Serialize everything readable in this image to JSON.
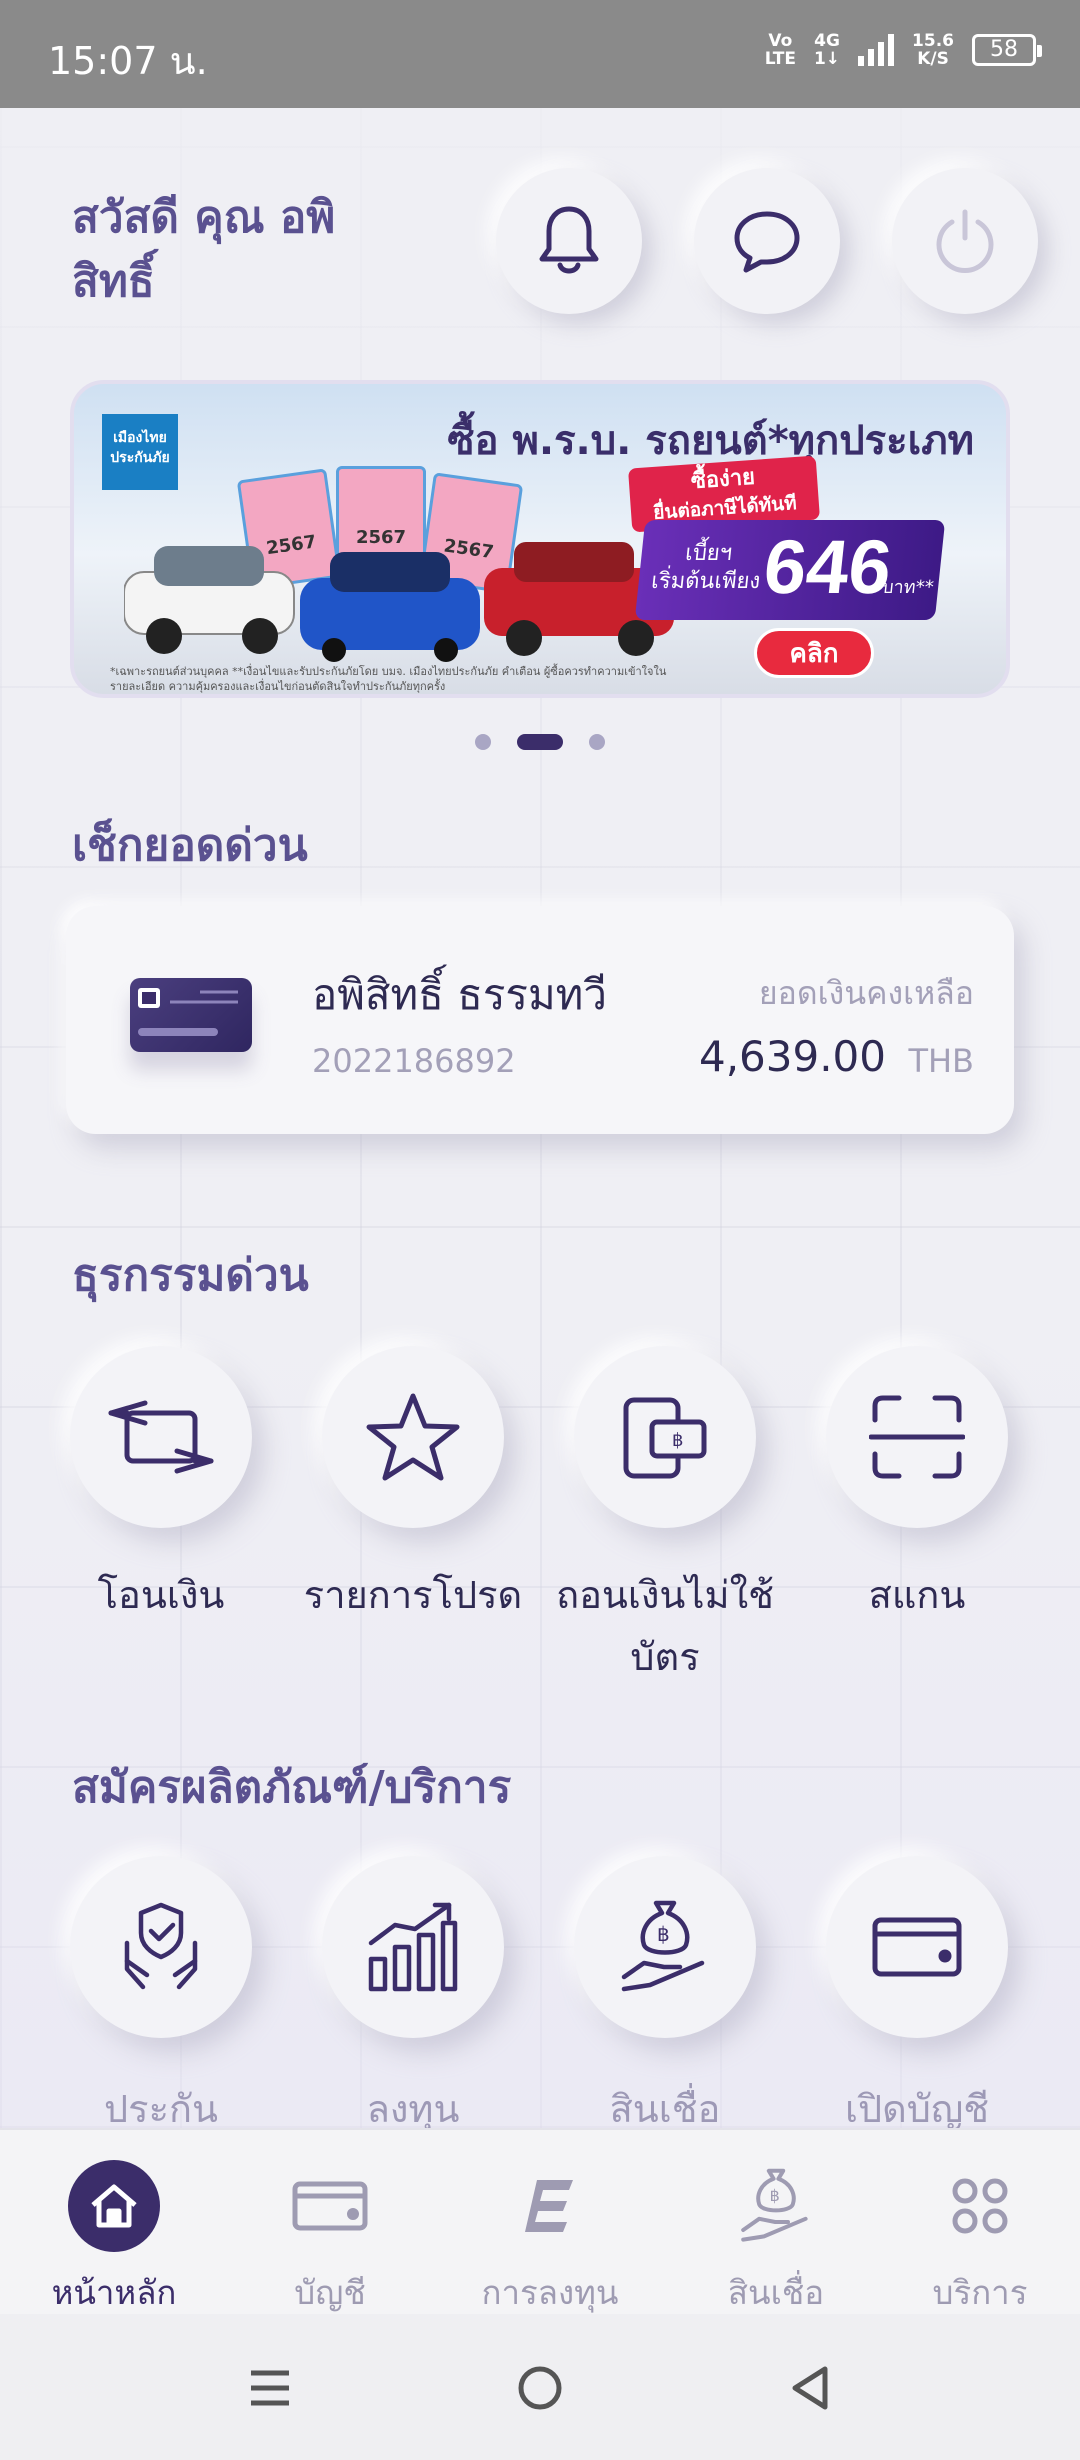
{
  "status_bar": {
    "time": "15:07 น.",
    "volte_top": "Vo",
    "volte_bottom": "LTE",
    "network_top": "4G",
    "network_bottom": "1↓",
    "speed_value": "15.6",
    "speed_unit": "K/S",
    "battery": "58"
  },
  "header": {
    "greeting": "สวัสดี คุณ อพิสิทธิ์",
    "buttons": [
      {
        "name": "notification",
        "icon": "bell-icon"
      },
      {
        "name": "chat",
        "icon": "chat-bubble-icon"
      },
      {
        "name": "logout",
        "icon": "power-icon"
      }
    ]
  },
  "banner": {
    "title": "ซื้อ พ.ร.บ. รถยนต์*ทุกประเภท",
    "logo_line1": "เมืองไทย",
    "logo_line2": "ประกันภัย",
    "tag1_line1": "ซื้อง่าย",
    "tag1_line2": "ยื่นต่อภาษีได้ทันที",
    "price_prefix_line1": "เบี้ยฯ",
    "price_prefix_line2": "เริ่มต้นเพียง",
    "price": "646",
    "price_unit": "บาท**",
    "cta": "คลิก",
    "sticker_number": "2567",
    "fine_print": "*เฉพาะรถยนต์ส่วนบุคคล **เงื่อนไขและรับประกันภัยโดย บมจ. เมืองไทยประกันภัย คำเตือน ผู้ซื้อควรทำความเข้าใจในรายละเอียด ความคุ้มครองและเงื่อนไขก่อนตัดสินใจทำประกันภัยทุกครั้ง",
    "page_count": 3,
    "active_page": 2
  },
  "balance": {
    "section_title": "เช็กยอดด่วน",
    "account_name": "อพิสิทธิ์ ธรรมทวี",
    "account_number": "2022186892",
    "balance_label": "ยอดเงินคงเหลือ",
    "amount": "4,639.00",
    "currency": "THB"
  },
  "quick_actions": {
    "section_title": "ธุรกรรมด่วน",
    "items": [
      {
        "label": "โอนเงิน",
        "icon": "transfer-icon"
      },
      {
        "label": "รายการโปรด",
        "icon": "star-icon"
      },
      {
        "label": "ถอนเงินไม่ใช้บัตร",
        "icon": "cardless-withdraw-icon"
      },
      {
        "label": "สแกน",
        "icon": "scan-icon"
      }
    ]
  },
  "products": {
    "section_title": "สมัครผลิตภัณฑ์/บริการ",
    "items": [
      {
        "label": "ประกัน",
        "icon": "insurance-icon"
      },
      {
        "label": "ลงทุน",
        "icon": "investment-chart-icon"
      },
      {
        "label": "สินเชื่อ",
        "icon": "loan-icon"
      },
      {
        "label": "เปิดบัญชี",
        "icon": "open-account-icon"
      }
    ]
  },
  "bottom_nav": {
    "items": [
      {
        "label": "หน้าหลัก",
        "icon": "home-icon",
        "active": true
      },
      {
        "label": "บัญชี",
        "icon": "account-card-icon",
        "active": false
      },
      {
        "label": "การลงทุน",
        "icon": "investment-e-icon",
        "active": false
      },
      {
        "label": "สินเชื่อ",
        "icon": "loan-icon",
        "active": false
      },
      {
        "label": "บริการ",
        "icon": "services-grid-icon",
        "active": false
      }
    ]
  },
  "colors": {
    "primary": "#3b2d6a",
    "heading": "#5a5190",
    "muted": "#9e9bb2",
    "background": "#efeff4",
    "banner_red": "#e82a3e",
    "banner_purple": "#5b2aa8"
  }
}
